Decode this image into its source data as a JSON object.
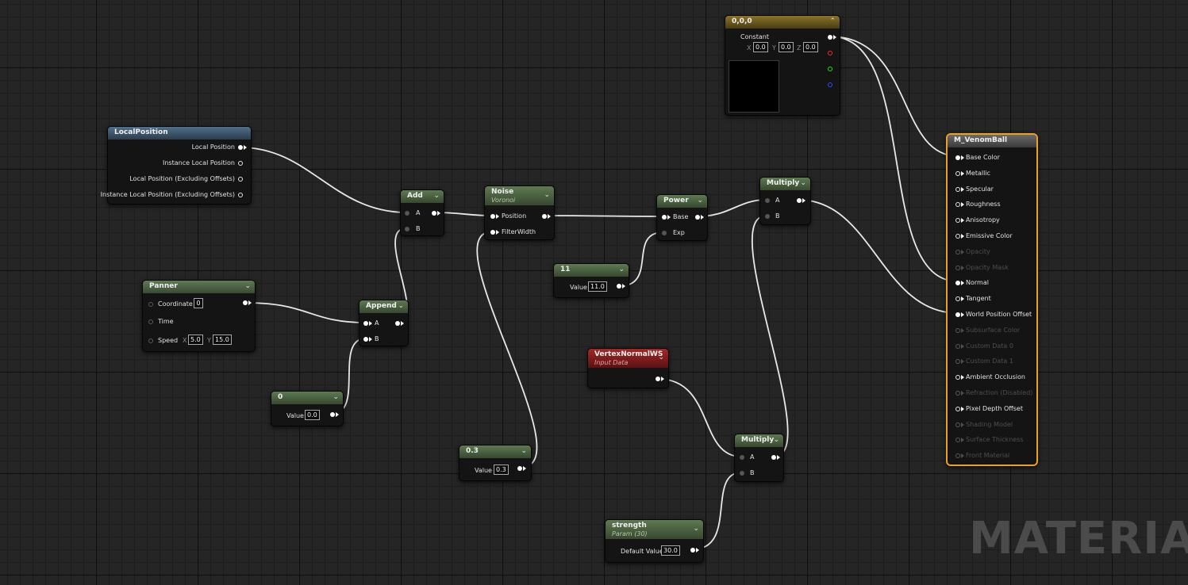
{
  "watermark": "MATERIAL",
  "nodes": {
    "constant3": {
      "title": "0,0,0",
      "output": "Constant",
      "x_label": "X",
      "x_value": "0.0",
      "y_label": "Y",
      "y_value": "0.0",
      "z_label": "Z",
      "z_value": "0.0"
    },
    "local_position": {
      "title": "LocalPosition",
      "outputs": [
        "Local Position",
        "Instance Local Position",
        "Local Position (Excluding Offsets)",
        "Instance Local Position (Excluding Offsets)"
      ]
    },
    "add": {
      "title": "Add",
      "inputs": [
        "A",
        "B"
      ]
    },
    "noise": {
      "title": "Noise",
      "subtitle": "Voronoi",
      "inputs": [
        "Position",
        "FilterWidth"
      ]
    },
    "power": {
      "title": "Power",
      "inputs": [
        "Base",
        "Exp"
      ]
    },
    "multiply_top": {
      "title": "Multiply",
      "inputs": [
        "A",
        "B"
      ]
    },
    "const11": {
      "title": "11",
      "value_label": "Value",
      "value": "11.0"
    },
    "panner": {
      "title": "Panner",
      "coordinate_label": "Coordinate",
      "coordinate_value": "0",
      "time_label": "Time",
      "speed_label": "Speed",
      "speed_x_label": "X",
      "speed_x": "5.0",
      "speed_y_label": "Y",
      "speed_y": "15.0"
    },
    "append": {
      "title": "Append",
      "inputs": [
        "A",
        "B"
      ]
    },
    "const0": {
      "title": "0",
      "value_label": "Value",
      "value": "0.0"
    },
    "const03": {
      "title": "0.3",
      "value_label": "Value",
      "value": "0.3"
    },
    "vertex_normal": {
      "title": "VertexNormalWS",
      "subtitle": "Input Data"
    },
    "multiply_bottom": {
      "title": "Multiply",
      "inputs": [
        "A",
        "B"
      ]
    },
    "strength": {
      "title": "strength",
      "subtitle": "Param (30)",
      "value_label": "Default Value",
      "value": "30.0"
    },
    "result": {
      "title": "M_VenomBall",
      "inputs": [
        {
          "label": "Base Color",
          "state": "connected"
        },
        {
          "label": "Metallic",
          "state": "enabled"
        },
        {
          "label": "Specular",
          "state": "enabled"
        },
        {
          "label": "Roughness",
          "state": "enabled"
        },
        {
          "label": "Anisotropy",
          "state": "enabled"
        },
        {
          "label": "Emissive Color",
          "state": "enabled"
        },
        {
          "label": "Opacity",
          "state": "disabled"
        },
        {
          "label": "Opacity Mask",
          "state": "disabled"
        },
        {
          "label": "Normal",
          "state": "connected"
        },
        {
          "label": "Tangent",
          "state": "enabled"
        },
        {
          "label": "World Position Offset",
          "state": "connected"
        },
        {
          "label": "Subsurface Color",
          "state": "disabled"
        },
        {
          "label": "Custom Data 0",
          "state": "disabled"
        },
        {
          "label": "Custom Data 1",
          "state": "disabled"
        },
        {
          "label": "Ambient Occlusion",
          "state": "enabled"
        },
        {
          "label": "Refraction (Disabled)",
          "state": "disabled"
        },
        {
          "label": "Pixel Depth Offset",
          "state": "enabled"
        },
        {
          "label": "Shading Model",
          "state": "disabled"
        },
        {
          "label": "Surface Thickness",
          "state": "disabled"
        },
        {
          "label": "Front Material",
          "state": "disabled"
        }
      ]
    }
  },
  "colors": {
    "grid_bg": "#252525",
    "result_border": "#f0a020",
    "wire": "#e8e8e8",
    "header_green": "#4e6a44",
    "header_blue": "#3e5a74",
    "header_red": "#8a1f1f",
    "header_gold": "#7a6420"
  }
}
